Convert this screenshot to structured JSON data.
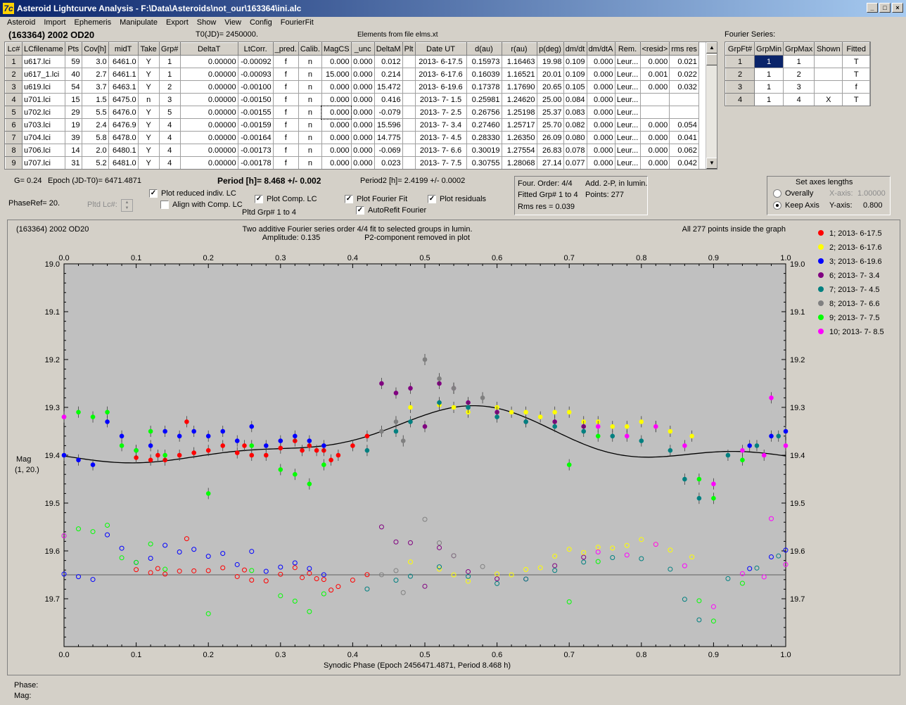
{
  "window": {
    "title": "Asteroid Lightcurve Analysis - F:\\Data\\Asteroids\\not_our\\163364\\ini.alc",
    "icon": "7c"
  },
  "menu": [
    "Asteroid",
    "Import",
    "Ephemeris",
    "Manipulate",
    "Export",
    "Show",
    "View",
    "Config",
    "FourierFit"
  ],
  "header": {
    "asteroid": "(163364) 2002 OD20",
    "t0": "T0(JD)= 2450000.",
    "elements": "Elements from file elms.xt",
    "fourier_label": "Fourier Series:"
  },
  "lc_table": {
    "columns": [
      "Lc#",
      "LCfilename",
      "Pts",
      "Cov[h]",
      "midT",
      "Take",
      "Grp#",
      "DeltaT",
      "LtCorr.",
      "_pred.",
      "Calib.",
      "MagCS",
      "_unc",
      "DeltaM",
      "Plt",
      "Date UT",
      "d(au)",
      "r(au)",
      "p(deg)",
      "dm/dt",
      "dm/dtA",
      "Rem.",
      "<resid>",
      "rms res"
    ],
    "rows": [
      [
        "1",
        "u617.lci",
        "59",
        "3.0",
        "6461.0",
        "Y",
        "1",
        "0.00000",
        "-0.00092",
        "f",
        "n",
        "0.000",
        "0.000",
        "0.012",
        "",
        "2013- 6-17.5",
        "0.15973",
        "1.16463",
        "19.98",
        "0.109",
        "0.000",
        "Leur...",
        "0.000",
        "0.021"
      ],
      [
        "2",
        "u617_1.lci",
        "40",
        "2.7",
        "6461.1",
        "Y",
        "1",
        "0.00000",
        "-0.00093",
        "f",
        "n",
        "15.000",
        "0.000",
        "0.214",
        "",
        "2013- 6-17.6",
        "0.16039",
        "1.16521",
        "20.01",
        "0.109",
        "0.000",
        "Leur...",
        "0.001",
        "0.022"
      ],
      [
        "3",
        "u619.lci",
        "54",
        "3.7",
        "6463.1",
        "Y",
        "2",
        "0.00000",
        "-0.00100",
        "f",
        "n",
        "0.000",
        "0.000",
        "15.472",
        "",
        "2013- 6-19.6",
        "0.17378",
        "1.17690",
        "20.65",
        "0.105",
        "0.000",
        "Leur...",
        "0.000",
        "0.032"
      ],
      [
        "4",
        "u701.lci",
        "15",
        "1.5",
        "6475.0",
        "n",
        "3",
        "0.00000",
        "-0.00150",
        "f",
        "n",
        "0.000",
        "0.000",
        "0.416",
        "",
        "2013- 7- 1.5",
        "0.25981",
        "1.24620",
        "25.00",
        "0.084",
        "0.000",
        "Leur...",
        "",
        ""
      ],
      [
        "5",
        "u702.lci",
        "29",
        "5.5",
        "6476.0",
        "Y",
        "5",
        "0.00000",
        "-0.00155",
        "f",
        "n",
        "0.000",
        "0.000",
        "-0.079",
        "",
        "2013- 7- 2.5",
        "0.26756",
        "1.25198",
        "25.37",
        "0.083",
        "0.000",
        "Leur...",
        "",
        ""
      ],
      [
        "6",
        "u703.lci",
        "19",
        "2.4",
        "6476.9",
        "Y",
        "4",
        "0.00000",
        "-0.00159",
        "f",
        "n",
        "0.000",
        "0.000",
        "15.596",
        "",
        "2013- 7- 3.4",
        "0.27460",
        "1.25717",
        "25.70",
        "0.082",
        "0.000",
        "Leur...",
        "0.000",
        "0.054"
      ],
      [
        "7",
        "u704.lci",
        "39",
        "5.8",
        "6478.0",
        "Y",
        "4",
        "0.00000",
        "-0.00164",
        "f",
        "n",
        "0.000",
        "0.000",
        "14.775",
        "",
        "2013- 7- 4.5",
        "0.28330",
        "1.26350",
        "26.09",
        "0.080",
        "0.000",
        "Leur...",
        "0.000",
        "0.041"
      ],
      [
        "8",
        "u706.lci",
        "14",
        "2.0",
        "6480.1",
        "Y",
        "4",
        "0.00000",
        "-0.00173",
        "f",
        "n",
        "0.000",
        "0.000",
        "-0.069",
        "",
        "2013- 7- 6.6",
        "0.30019",
        "1.27554",
        "26.83",
        "0.078",
        "0.000",
        "Leur...",
        "0.000",
        "0.062"
      ],
      [
        "9",
        "u707.lci",
        "31",
        "5.2",
        "6481.0",
        "Y",
        "4",
        "0.00000",
        "-0.00178",
        "f",
        "n",
        "0.000",
        "0.000",
        "0.023",
        "",
        "2013- 7- 7.5",
        "0.30755",
        "1.28068",
        "27.14",
        "0.077",
        "0.000",
        "Leur...",
        "0.000",
        "0.042"
      ]
    ]
  },
  "fourier_table": {
    "columns": [
      "GrpFt#",
      "GrpMin",
      "GrpMax",
      "Shown",
      "Fitted"
    ],
    "rows": [
      [
        "1",
        "1",
        "1",
        "",
        "T"
      ],
      [
        "2",
        "1",
        "2",
        "",
        "T"
      ],
      [
        "3",
        "1",
        "3",
        "",
        "f"
      ],
      [
        "4",
        "1",
        "4",
        "X",
        "T"
      ]
    ]
  },
  "controls": {
    "g": "G= 0.24",
    "epoch": "Epoch (JD-T0)= 6471.4871",
    "period": "Period [h]= 8.468 +/- 0.002",
    "period2": "Period2 [h]= 2.4199 +/- 0.0002",
    "phaseref": "PhaseRef= 20.",
    "pltd_lc": "Pltd Lc#:",
    "plot_reduced": "Plot reduced indiv. LC",
    "align": "Align with Comp. LC",
    "plot_comp": "Plot Comp. LC",
    "pltd_grp": "Pltd Grp#  1   to    4",
    "plot_fourier": "Plot Fourier Fit",
    "plot_residuals": "Plot residuals",
    "autorefit": "AutoRefit Fourier"
  },
  "fourier_info": {
    "order": "Four. Order:  4/4",
    "add": "Add. 2-P, in lumin.",
    "fitted": "Fitted Grp# 1 to 4",
    "points": "Points: 277",
    "rms": "Rms res      = 0.039"
  },
  "axes_panel": {
    "title": "Set axes lengths",
    "overally": "Overally",
    "keep": "Keep Axis",
    "xaxis_label": "X-axis:",
    "xaxis_val": "1.00000",
    "yaxis_label": "Y-axis:",
    "yaxis_val": "0.800"
  },
  "footer": {
    "phase": "Phase:",
    "mag": "Mag:"
  },
  "chart_data": {
    "type": "scatter",
    "title_left": "(163364) 2002 OD20",
    "title": "Two additive Fourier series order 4/4 fit to selected groups in lumin.",
    "subtitle1": "Amplitude: 0.135",
    "subtitle2": "P2-component removed in plot",
    "title_right": "All 277 points inside the graph",
    "xlabel": "Synodic Phase (Epoch 2456471.4871, Period 8.468 h)",
    "ylabel": "Mag",
    "ylabel2": "(1, 20.)",
    "xlim": [
      0.0,
      1.0
    ],
    "ylim": [
      19.0,
      19.8
    ],
    "x_ticks": [
      "0.0",
      "0.1",
      "0.2",
      "0.3",
      "0.4",
      "0.5",
      "0.6",
      "0.7",
      "0.8",
      "0.9",
      "1.0"
    ],
    "y_ticks": [
      "19.0",
      "19.1",
      "19.2",
      "19.3",
      "19.4",
      "19.5",
      "19.6",
      "19.7"
    ],
    "residual_zero": 19.65,
    "series": [
      {
        "name": "1; 2013- 6-17.5",
        "color": "#ff0000"
      },
      {
        "name": "2; 2013- 6-17.6",
        "color": "#ffff00"
      },
      {
        "name": "3; 2013- 6-19.6",
        "color": "#0000ff"
      },
      {
        "name": "6; 2013- 7- 3.4",
        "color": "#800080"
      },
      {
        "name": "7; 2013- 7- 4.5",
        "color": "#008080"
      },
      {
        "name": "8; 2013- 7- 6.6",
        "color": "#808080"
      },
      {
        "name": "9; 2013- 7- 7.5",
        "color": "#00ff00"
      },
      {
        "name": "10; 2013- 7- 8.5",
        "color": "#ff00ff"
      }
    ],
    "point_data": [
      [
        0,
        [
          0.1,
          19.405,
          0.12,
          19.41,
          0.14,
          19.41,
          0.16,
          19.4,
          0.18,
          19.395,
          0.2,
          19.39,
          0.22,
          19.38,
          0.24,
          19.395,
          0.26,
          19.4,
          0.28,
          19.4,
          0.3,
          19.385,
          0.32,
          19.37,
          0.34,
          19.38,
          0.36,
          19.39,
          0.38,
          19.4,
          0.4,
          19.38,
          0.42,
          19.36,
          0.13,
          19.4,
          0.25,
          19.38,
          0.33,
          19.39,
          0.37,
          19.41,
          0.17,
          19.33,
          0.35,
          19.39
        ]
      ],
      [
        1,
        [
          0.48,
          19.3,
          0.52,
          19.295,
          0.56,
          19.31,
          0.6,
          19.3,
          0.64,
          19.31,
          0.68,
          19.31,
          0.72,
          19.33,
          0.76,
          19.34,
          0.8,
          19.33,
          0.84,
          19.35,
          0.87,
          19.36,
          0.54,
          19.3,
          0.62,
          19.31,
          0.66,
          19.32,
          0.7,
          19.31,
          0.74,
          19.33,
          0.78,
          19.34,
          0.82,
          19.34
        ]
      ],
      [
        2,
        [
          0.0,
          19.4,
          0.02,
          19.41,
          0.04,
          19.42,
          0.06,
          19.33,
          0.08,
          19.36,
          0.1,
          19.39,
          0.12,
          19.38,
          0.14,
          19.35,
          0.16,
          19.36,
          0.18,
          19.35,
          0.2,
          19.36,
          0.22,
          19.35,
          0.24,
          19.37,
          0.26,
          19.34,
          0.28,
          19.38,
          0.3,
          19.37,
          0.32,
          19.36,
          0.34,
          19.37,
          0.36,
          19.38,
          0.95,
          19.38,
          0.98,
          19.36,
          1.0,
          19.35
        ]
      ],
      [
        3,
        [
          0.44,
          19.25,
          0.46,
          19.27,
          0.48,
          19.26,
          0.5,
          19.34,
          0.52,
          19.25,
          0.54,
          19.26,
          0.56,
          19.29,
          0.6,
          19.31,
          0.64,
          19.33,
          0.68,
          19.33,
          0.72,
          19.34
        ]
      ],
      [
        4,
        [
          0.42,
          19.39,
          0.46,
          19.35,
          0.48,
          19.33,
          0.52,
          19.29,
          0.56,
          19.3,
          0.6,
          19.32,
          0.64,
          19.33,
          0.68,
          19.34,
          0.72,
          19.35,
          0.76,
          19.36,
          0.8,
          19.37,
          0.84,
          19.39,
          0.86,
          19.45,
          0.88,
          19.49,
          0.92,
          19.4,
          0.96,
          19.38,
          0.99,
          19.36
        ]
      ],
      [
        5,
        [
          0.44,
          19.35,
          0.46,
          19.33,
          0.5,
          19.2,
          0.52,
          19.24,
          0.54,
          19.26,
          0.58,
          19.28,
          0.47,
          19.37
        ]
      ],
      [
        6,
        [
          0.0,
          19.32,
          0.02,
          19.31,
          0.04,
          19.32,
          0.06,
          19.31,
          0.08,
          19.38,
          0.1,
          19.39,
          0.12,
          19.35,
          0.14,
          19.4,
          0.2,
          19.48,
          0.26,
          19.38,
          0.3,
          19.43,
          0.32,
          19.44,
          0.34,
          19.46,
          0.36,
          19.42,
          0.7,
          19.42,
          0.74,
          19.36,
          0.88,
          19.45,
          0.9,
          19.49,
          0.94,
          19.41
        ]
      ],
      [
        7,
        [
          0.0,
          19.32,
          0.74,
          19.34,
          0.78,
          19.36,
          0.82,
          19.34,
          0.86,
          19.38,
          0.9,
          19.46,
          0.94,
          19.39,
          0.97,
          19.4,
          0.98,
          19.28,
          1.0,
          19.38
        ]
      ]
    ]
  }
}
